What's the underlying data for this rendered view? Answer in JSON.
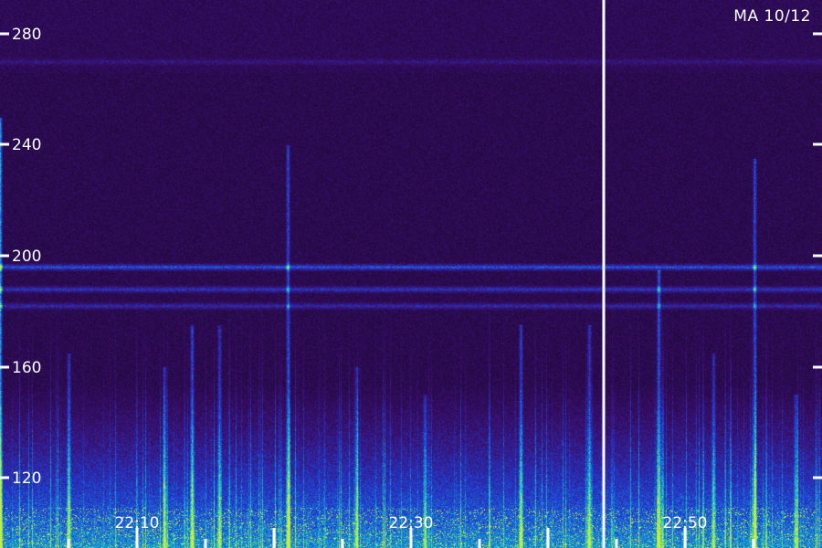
{
  "chart_data": {
    "type": "heatmap",
    "title": "",
    "station_label": "MA 10/12",
    "ylabel": "",
    "xlabel": "",
    "ylim": [
      105,
      290
    ],
    "y_ticks": [
      120,
      160,
      200,
      240,
      280
    ],
    "x_tick_labels": [
      "22:10",
      "22:30",
      "22:50"
    ],
    "time_break_after": "22:40",
    "colors": {
      "background": "#150628",
      "low": "#3a0f6e",
      "mid": "#1f3fd6",
      "high": "#18c9c9",
      "peak": "#c8f03a",
      "annotation": "#ffffff"
    },
    "horizontal_bands": [
      {
        "y": 188,
        "intensity": 0.35
      },
      {
        "y": 196,
        "intensity": 0.45
      },
      {
        "y": 182,
        "intensity": 0.3
      },
      {
        "y": 270,
        "intensity": 0.15
      }
    ],
    "vertical_bursts": [
      {
        "time": "22:00",
        "y_top": 250,
        "intensity": 0.95
      },
      {
        "time": "22:05",
        "y_top": 165,
        "intensity": 0.6
      },
      {
        "time": "22:12",
        "y_top": 160,
        "intensity": 0.55
      },
      {
        "time": "22:14",
        "y_top": 175,
        "intensity": 0.7
      },
      {
        "time": "22:16",
        "y_top": 175,
        "intensity": 0.6
      },
      {
        "time": "22:21",
        "y_top": 240,
        "intensity": 0.7
      },
      {
        "time": "22:26",
        "y_top": 160,
        "intensity": 0.5
      },
      {
        "time": "22:31",
        "y_top": 150,
        "intensity": 0.5
      },
      {
        "time": "22:38",
        "y_top": 175,
        "intensity": 0.65
      },
      {
        "time": "22:43",
        "y_top": 175,
        "intensity": 0.6
      },
      {
        "time": "22:48",
        "y_top": 195,
        "intensity": 0.75
      },
      {
        "time": "22:52",
        "y_top": 165,
        "intensity": 0.55
      },
      {
        "time": "22:55",
        "y_top": 235,
        "intensity": 0.7
      },
      {
        "time": "22:58",
        "y_top": 150,
        "intensity": 0.5
      }
    ]
  }
}
